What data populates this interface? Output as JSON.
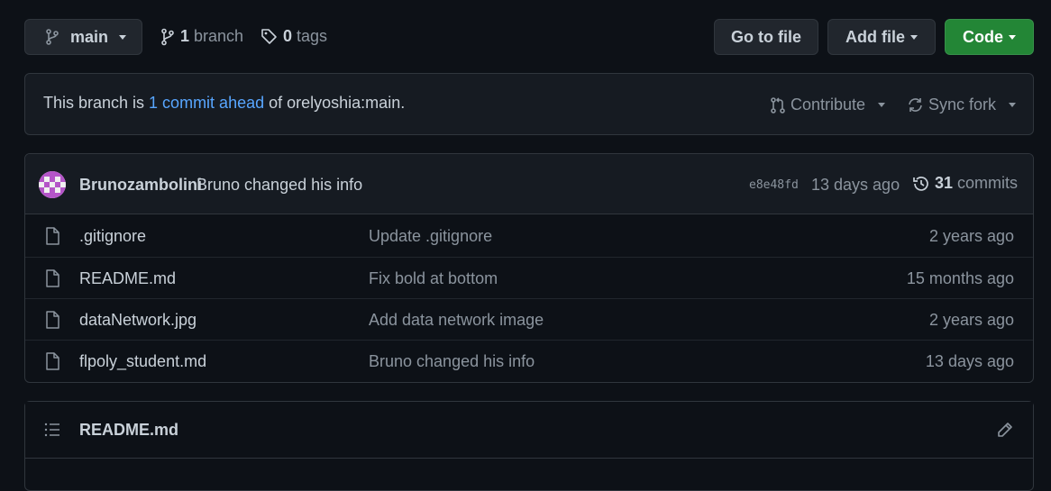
{
  "toolbar": {
    "branch_button": "main",
    "branch_count": "1",
    "branch_label": "branch",
    "tag_count": "0",
    "tag_label": "tags",
    "go_to_file": "Go to file",
    "add_file": "Add file",
    "code": "Code"
  },
  "ahead_banner": {
    "prefix": "This branch is ",
    "link": "1 commit ahead",
    "suffix": " of orelyoshia:main.",
    "contribute": "Contribute",
    "sync_fork": "Sync fork"
  },
  "latest_commit": {
    "author": "Brunozambolini",
    "message": "Bruno changed his info",
    "sha": "e8e48fd",
    "age": "13 days ago",
    "commit_count": "31",
    "commits_label": "commits"
  },
  "files": [
    {
      "name": ".gitignore",
      "message": "Update .gitignore",
      "age": "2 years ago"
    },
    {
      "name": "README.md",
      "message": "Fix bold at bottom",
      "age": "15 months ago"
    },
    {
      "name": "dataNetwork.jpg",
      "message": "Add data network image",
      "age": "2 years ago"
    },
    {
      "name": "flpoly_student.md",
      "message": "Bruno changed his info",
      "age": "13 days ago"
    }
  ],
  "readme": {
    "title": "README.md"
  },
  "colors": {
    "background": "#0d1117",
    "panel": "#161b22",
    "border": "#30363d",
    "link": "#58a6ff",
    "green_button": "#238636",
    "muted_text": "#8b949e"
  },
  "icons": [
    "git-branch-icon",
    "tag-icon",
    "git-pull-request-icon",
    "sync-icon",
    "history-icon",
    "file-icon",
    "list-icon",
    "pencil-icon",
    "avatar-identicon"
  ]
}
